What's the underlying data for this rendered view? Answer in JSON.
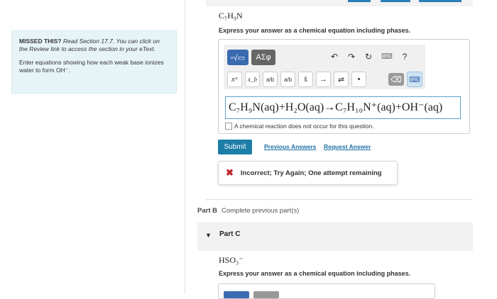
{
  "hint": {
    "missed_label": "MISSED THIS?",
    "missed_text": "Read Section 17.7. You can click on the Review link to access the section in your eText.",
    "instruction": "Enter equations showing how each weak base ionizes water to form OH⁻."
  },
  "part_a": {
    "formula": "C₇H₉N",
    "instruction": "Express your answer as a chemical equation including phases.",
    "toolbar": {
      "template_btn": "▫√▭",
      "greek_btn": "ΑΣφ",
      "undo_icon": "↶",
      "redo_icon": "↷",
      "reset_icon": "↻",
      "keyboard_icon": "⌨",
      "help_icon": "?",
      "row2": [
        "xᵃ",
        "x_b",
        "a/b",
        "a/b",
        "x̄",
        "→",
        "⇌",
        "•"
      ],
      "delete_icon": "⌫",
      "keyboard2_icon": "⌨"
    },
    "answer": "C₇H₉N(aq)+H₂O(aq)→C₇H₁₀N⁺(aq)+OH⁻(aq)",
    "no_reaction_label": "A chemical reaction does not occur for this question.",
    "submit_label": "Submit",
    "previous_answers_label": "Previous Answers",
    "request_answer_label": "Request Answer",
    "feedback": "Incorrect; Try Again; One attempt remaining"
  },
  "part_b": {
    "label": "Part B",
    "status": "Complete previous part(s)"
  },
  "part_c": {
    "label": "Part C",
    "formula": "HSO₃⁻",
    "instruction": "Express your answer as a chemical equation including phases."
  }
}
